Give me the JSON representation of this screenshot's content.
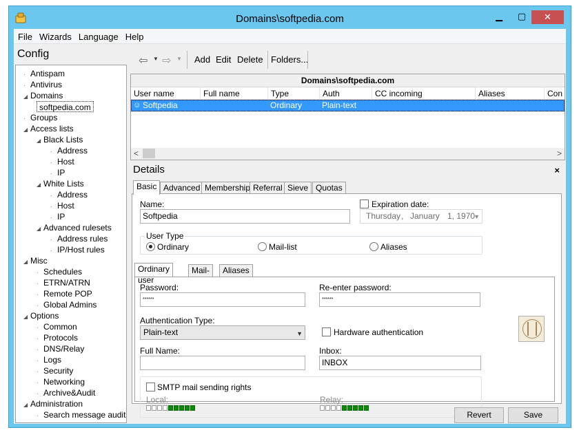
{
  "window": {
    "title": "Domains\\softpedia.com"
  },
  "menu": [
    "File",
    "Wizards",
    "Language",
    "Help"
  ],
  "config": {
    "header": "Config"
  },
  "tree": [
    {
      "label": "Antispam",
      "level": 1,
      "exp": ""
    },
    {
      "label": "Antivirus",
      "level": 1,
      "exp": ""
    },
    {
      "label": "Domains",
      "level": 1,
      "exp": "▲"
    },
    {
      "label": "softpedia.com",
      "level": 2,
      "exp": "",
      "selected": true
    },
    {
      "label": "Groups",
      "level": 1,
      "exp": ""
    },
    {
      "label": "Access lists",
      "level": 1,
      "exp": "▲"
    },
    {
      "label": "Black Lists",
      "level": 2,
      "exp": "▲"
    },
    {
      "label": "Address",
      "level": 3,
      "exp": ""
    },
    {
      "label": "Host",
      "level": 3,
      "exp": ""
    },
    {
      "label": "IP",
      "level": 3,
      "exp": ""
    },
    {
      "label": "White Lists",
      "level": 2,
      "exp": "▲"
    },
    {
      "label": "Address",
      "level": 3,
      "exp": ""
    },
    {
      "label": "Host",
      "level": 3,
      "exp": ""
    },
    {
      "label": "IP",
      "level": 3,
      "exp": ""
    },
    {
      "label": "Advanced rulesets",
      "level": 2,
      "exp": "▲"
    },
    {
      "label": "Address rules",
      "level": 3,
      "exp": ""
    },
    {
      "label": "IP/Host rules",
      "level": 3,
      "exp": ""
    },
    {
      "label": "Misc",
      "level": 1,
      "exp": "▲"
    },
    {
      "label": "Schedules",
      "level": 2,
      "exp": ""
    },
    {
      "label": "ETRN/ATRN",
      "level": 2,
      "exp": ""
    },
    {
      "label": "Remote POP",
      "level": 2,
      "exp": ""
    },
    {
      "label": "Global Admins",
      "level": 2,
      "exp": ""
    },
    {
      "label": "Options",
      "level": 1,
      "exp": "▲"
    },
    {
      "label": "Common",
      "level": 2,
      "exp": ""
    },
    {
      "label": "Protocols",
      "level": 2,
      "exp": ""
    },
    {
      "label": "DNS/Relay",
      "level": 2,
      "exp": ""
    },
    {
      "label": "Logs",
      "level": 2,
      "exp": ""
    },
    {
      "label": "Security",
      "level": 2,
      "exp": ""
    },
    {
      "label": "Networking",
      "level": 2,
      "exp": ""
    },
    {
      "label": "Archive&Audit",
      "level": 2,
      "exp": ""
    },
    {
      "label": "Administration",
      "level": 1,
      "exp": "▲"
    },
    {
      "label": "Search message audit",
      "level": 2,
      "exp": ""
    }
  ],
  "toolbar": {
    "add": "Add",
    "edit": "Edit",
    "delete": "Delete",
    "folders": "Folders..."
  },
  "grid": {
    "title": "Domains\\softpedia.com",
    "columns": [
      "User name",
      "Full name",
      "Type",
      "Auth",
      "CC incoming",
      "Aliases",
      "Con"
    ],
    "rows": [
      {
        "user": "Softpedia",
        "full": "",
        "type": "Ordinary",
        "auth": "Plain-text",
        "cc": "",
        "aliases": "",
        "con": ""
      }
    ]
  },
  "details": {
    "title": "Details",
    "close": "×",
    "tabs": [
      "Basic",
      "Advanced",
      "Membership",
      "Referral",
      "Sieve",
      "Quotas"
    ],
    "name_label": "Name:",
    "name_value": "Softpedia",
    "expiration_label": "Expiration date:",
    "date": {
      "weekday": "Thursday",
      "sep": ",",
      "month": "January",
      "day": "1, 1970"
    },
    "user_type_label": "User Type",
    "user_types": [
      "Ordinary",
      "Mail-list",
      "Aliases"
    ],
    "subtabs": [
      "Ordinary user",
      "Mail-list",
      "Aliases"
    ],
    "password_label": "Password:",
    "password_value": "******",
    "reenter_label": "Re-enter password:",
    "reenter_value": "******",
    "auth_type_label": "Authentication Type:",
    "auth_type_value": "Plain-text",
    "hw_auth_label": "Hardware authentication",
    "fullname_label": "Full Name:",
    "fullname_value": "",
    "inbox_label": "Inbox:",
    "inbox_value": "INBOX",
    "smtp_label": "SMTP mail sending rights",
    "local_label": "Local:",
    "relay_label": "Relay:",
    "local_level": 5,
    "relay_level": 5,
    "meter_cells": 9
  },
  "buttons": {
    "revert": "Revert",
    "save": "Save"
  }
}
